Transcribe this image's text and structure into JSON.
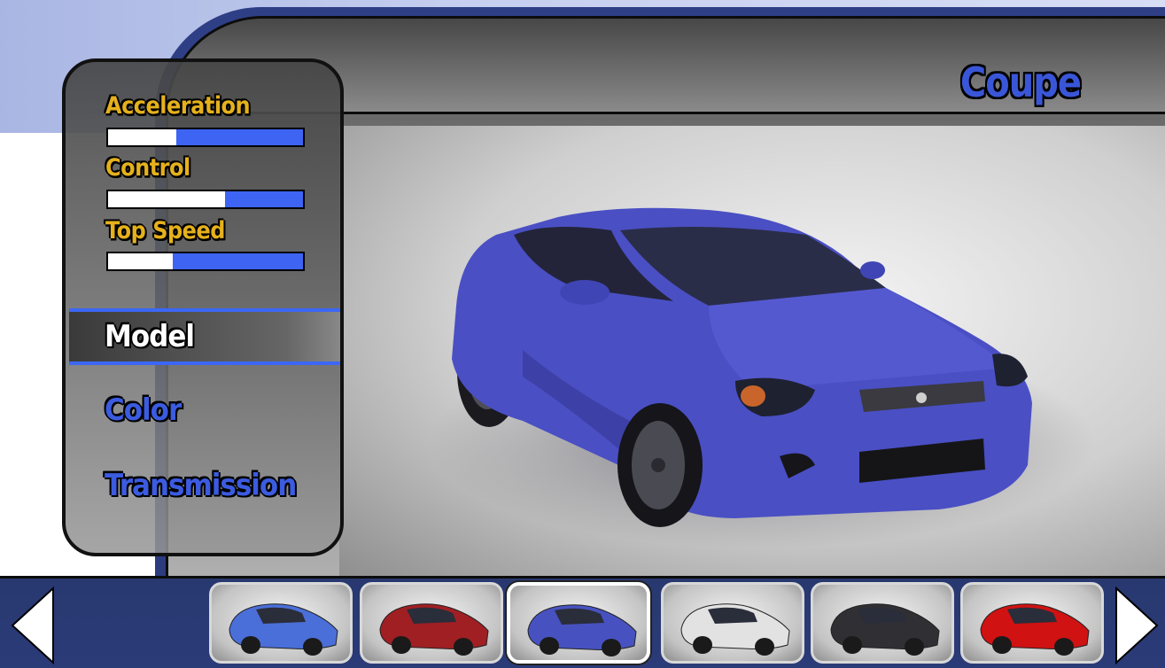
{
  "car_title": "Coupe",
  "stats": [
    {
      "label": "Acceleration",
      "fill_fraction": 0.35
    },
    {
      "label": "Control",
      "fill_fraction": 0.6
    },
    {
      "label": "Top Speed",
      "fill_fraction": 0.33
    }
  ],
  "menu": {
    "items": [
      "Model",
      "Color",
      "Transmission"
    ],
    "selected": "Model"
  },
  "thumbnails": [
    {
      "model": "hatchback",
      "color": "#4a6fd8"
    },
    {
      "model": "suv",
      "color": "#a01f22"
    },
    {
      "model": "coupe",
      "color": "#4752c0",
      "selected": true
    },
    {
      "model": "pickup",
      "color": "#e2e2e2"
    },
    {
      "model": "sports-car-dark",
      "color": "#303034"
    },
    {
      "model": "sports-car-red",
      "color": "#d01212"
    }
  ],
  "colors": {
    "accent_blue": "#3c67f5",
    "label_gold": "#e5b11c",
    "car_body": "#4a4fc4"
  }
}
